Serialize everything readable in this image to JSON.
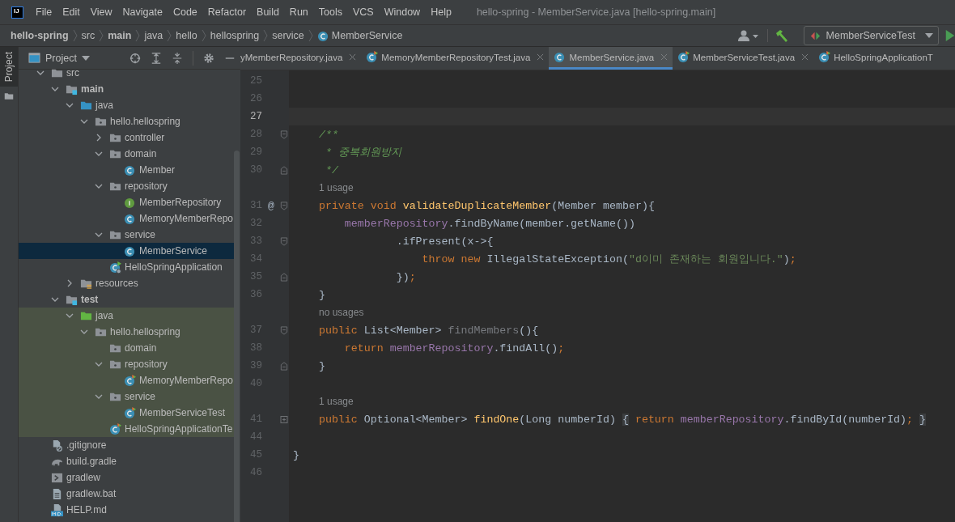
{
  "app": {
    "logo": "IJ",
    "title": "hello-spring - MemberService.java [hello-spring.main]"
  },
  "menu": [
    "File",
    "Edit",
    "View",
    "Navigate",
    "Code",
    "Refactor",
    "Build",
    "Run",
    "Tools",
    "VCS",
    "Window",
    "Help"
  ],
  "breadcrumbs": [
    {
      "label": "hello-spring",
      "bold": true
    },
    {
      "label": "src",
      "bold": false
    },
    {
      "label": "main",
      "bold": true
    },
    {
      "label": "java",
      "bold": false
    },
    {
      "label": "hello",
      "bold": false
    },
    {
      "label": "hellospring",
      "bold": false
    },
    {
      "label": "service",
      "bold": false
    },
    {
      "label": "MemberService",
      "bold": false,
      "kind": "class"
    }
  ],
  "run_config": {
    "label": "MemberServiceTest"
  },
  "side_stripe": {
    "label": "Project",
    "selected": true
  },
  "project": {
    "title": "Project",
    "tree": [
      {
        "label": "src",
        "kind": "folder",
        "expanded": true,
        "bold": false,
        "selected": false,
        "highlighted": false,
        "children": [
          {
            "label": "main",
            "kind": "source-folder",
            "expanded": true,
            "bold": true,
            "selected": false,
            "highlighted": false,
            "children": [
              {
                "label": "java",
                "kind": "java-folder",
                "expanded": true,
                "bold": false,
                "selected": false,
                "highlighted": false,
                "children": [
                  {
                    "label": "hello.hellospring",
                    "kind": "package",
                    "expanded": true,
                    "bold": false,
                    "selected": false,
                    "highlighted": false,
                    "children": [
                      {
                        "label": "controller",
                        "kind": "package",
                        "expanded": false,
                        "bold": false,
                        "selected": false,
                        "highlighted": false
                      },
                      {
                        "label": "domain",
                        "kind": "package",
                        "expanded": true,
                        "bold": false,
                        "selected": false,
                        "highlighted": false,
                        "children": [
                          {
                            "label": "Member",
                            "kind": "class",
                            "bold": false,
                            "selected": false,
                            "highlighted": false
                          }
                        ]
                      },
                      {
                        "label": "repository",
                        "kind": "package",
                        "expanded": true,
                        "bold": false,
                        "selected": false,
                        "highlighted": false,
                        "children": [
                          {
                            "label": "MemberRepository",
                            "kind": "interface",
                            "bold": false,
                            "selected": false,
                            "highlighted": false
                          },
                          {
                            "label": "MemoryMemberRepo",
                            "kind": "class",
                            "bold": false,
                            "selected": false,
                            "highlighted": false
                          }
                        ]
                      },
                      {
                        "label": "service",
                        "kind": "package",
                        "expanded": true,
                        "bold": false,
                        "selected": false,
                        "highlighted": false,
                        "children": [
                          {
                            "label": "MemberService",
                            "kind": "class",
                            "bold": false,
                            "selected": true,
                            "highlighted": false
                          }
                        ]
                      },
                      {
                        "label": "HelloSpringApplication",
                        "kind": "spring-app",
                        "bold": false,
                        "selected": false,
                        "highlighted": false
                      }
                    ]
                  }
                ]
              },
              {
                "label": "resources",
                "kind": "resources",
                "expanded": false,
                "bold": false,
                "selected": false,
                "highlighted": false
              }
            ]
          },
          {
            "label": "test",
            "kind": "source-folder",
            "expanded": true,
            "bold": true,
            "selected": false,
            "highlighted": false,
            "children": [
              {
                "label": "java",
                "kind": "test-java-folder",
                "expanded": true,
                "bold": false,
                "selected": false,
                "highlighted": true,
                "children": [
                  {
                    "label": "hello.hellospring",
                    "kind": "package",
                    "expanded": true,
                    "bold": false,
                    "selected": false,
                    "highlighted": true,
                    "children": [
                      {
                        "label": "domain",
                        "kind": "package",
                        "bold": false,
                        "selected": false,
                        "highlighted": true
                      },
                      {
                        "label": "repository",
                        "kind": "package",
                        "expanded": true,
                        "bold": false,
                        "selected": false,
                        "highlighted": true,
                        "children": [
                          {
                            "label": "MemoryMemberRepo",
                            "kind": "test-class",
                            "bold": false,
                            "selected": false,
                            "highlighted": true
                          }
                        ]
                      },
                      {
                        "label": "service",
                        "kind": "package",
                        "expanded": true,
                        "bold": false,
                        "selected": false,
                        "highlighted": true,
                        "children": [
                          {
                            "label": "MemberServiceTest",
                            "kind": "test-class",
                            "bold": false,
                            "selected": false,
                            "highlighted": true
                          }
                        ]
                      },
                      {
                        "label": "HelloSpringApplicationTe",
                        "kind": "test-class",
                        "bold": false,
                        "selected": false,
                        "highlighted": true
                      }
                    ]
                  }
                ]
              }
            ]
          }
        ]
      },
      {
        "label": ".gitignore",
        "kind": "gitignore",
        "bold": false,
        "selected": false,
        "highlighted": false
      },
      {
        "label": "build.gradle",
        "kind": "gradle",
        "bold": false,
        "selected": false,
        "highlighted": false
      },
      {
        "label": "gradlew",
        "kind": "script",
        "bold": false,
        "selected": false,
        "highlighted": false
      },
      {
        "label": "gradlew.bat",
        "kind": "text-file",
        "bold": false,
        "selected": false,
        "highlighted": false
      },
      {
        "label": "HELP.md",
        "kind": "markdown",
        "bold": false,
        "selected": false,
        "highlighted": false
      }
    ]
  },
  "tabs": [
    {
      "label": "yMemberRepository.java",
      "selected": false,
      "closable": true
    },
    {
      "label": "MemoryMemberRepositoryTest.java",
      "kind": "test-class",
      "selected": false,
      "closable": true
    },
    {
      "label": "MemberService.java",
      "kind": "class",
      "selected": true,
      "closable": true
    },
    {
      "label": "MemberServiceTest.java",
      "kind": "test-class",
      "selected": false,
      "closable": true
    },
    {
      "label": "HelloSpringApplicationT",
      "kind": "test-class",
      "selected": false,
      "closable": false
    }
  ],
  "code": [
    {
      "kind": "line",
      "number": "25",
      "current": false
    },
    {
      "kind": "line",
      "number": "26",
      "current": false
    },
    {
      "kind": "line",
      "number": "27",
      "current": true
    },
    {
      "kind": "fold-start",
      "number": "28",
      "current": false,
      "tokens": [
        {
          "text": "    /**",
          "kind": "comment"
        }
      ]
    },
    {
      "kind": "line",
      "number": "29",
      "current": false,
      "tokens": [
        {
          "text": "     * 중복회원방지",
          "kind": "comment"
        }
      ]
    },
    {
      "kind": "fold-end",
      "number": "30",
      "current": false,
      "tokens": [
        {
          "text": "     */",
          "kind": "comment"
        }
      ]
    },
    {
      "kind": "hint",
      "hint": "1 usage"
    },
    {
      "kind": "fold-start",
      "number": "31",
      "current": false,
      "marker": "@",
      "tokens": [
        {
          "text": "    private void ",
          "kind": "keyword"
        },
        {
          "text": "validateDuplicateMember",
          "kind": "method"
        },
        {
          "text": "(Member member){",
          "kind": "plain"
        }
      ]
    },
    {
      "kind": "line",
      "number": "32",
      "current": false,
      "tokens": [
        {
          "text": "        memberRepository",
          "kind": "field"
        },
        {
          "text": ".findByName(member.getName())",
          "kind": "plain"
        }
      ]
    },
    {
      "kind": "fold-start",
      "number": "33",
      "current": false,
      "tokens": [
        {
          "text": "                .ifPresent(x->{",
          "kind": "plain"
        }
      ]
    },
    {
      "kind": "line",
      "number": "34",
      "current": false,
      "tokens": [
        {
          "text": "                    throw new ",
          "kind": "keyword"
        },
        {
          "text": "IllegalStateException(",
          "kind": "plain"
        },
        {
          "text": "\"d이미 존재하는 회원입니다.\"",
          "kind": "string"
        },
        {
          "text": ")",
          "kind": "plain"
        },
        {
          "text": ";",
          "kind": "punct"
        }
      ]
    },
    {
      "kind": "fold-end",
      "number": "35",
      "current": false,
      "tokens": [
        {
          "text": "                })",
          "kind": "plain"
        },
        {
          "text": ";",
          "kind": "punct"
        }
      ]
    },
    {
      "kind": "line",
      "number": "36",
      "current": false,
      "tokens": [
        {
          "text": "    }",
          "kind": "plain"
        }
      ]
    },
    {
      "kind": "hint",
      "hint": "no usages"
    },
    {
      "kind": "fold-start",
      "number": "37",
      "current": false,
      "tokens": [
        {
          "text": "    public ",
          "kind": "keyword"
        },
        {
          "text": "List<Member> ",
          "kind": "plain"
        },
        {
          "text": "findMembers",
          "kind": "unused"
        },
        {
          "text": "(){",
          "kind": "plain"
        }
      ]
    },
    {
      "kind": "line",
      "number": "38",
      "current": false,
      "tokens": [
        {
          "text": "        return ",
          "kind": "keyword"
        },
        {
          "text": "memberRepository",
          "kind": "field"
        },
        {
          "text": ".findAll()",
          "kind": "plain"
        },
        {
          "text": ";",
          "kind": "punct"
        }
      ]
    },
    {
      "kind": "fold-end",
      "number": "39",
      "current": false,
      "tokens": [
        {
          "text": "    }",
          "kind": "plain"
        }
      ]
    },
    {
      "kind": "line",
      "number": "40",
      "current": false
    },
    {
      "kind": "hint",
      "hint": "1 usage"
    },
    {
      "kind": "folded",
      "number": "41",
      "current": false,
      "tokens": [
        {
          "text": "    public ",
          "kind": "keyword"
        },
        {
          "text": "Optional<Member> ",
          "kind": "plain"
        },
        {
          "text": "findOne",
          "kind": "method"
        },
        {
          "text": "(Long numberId) ",
          "kind": "plain"
        },
        {
          "text": "{",
          "kind": "folded"
        },
        {
          "text": " return ",
          "kind": "keyword"
        },
        {
          "text": "memberRepository",
          "kind": "field"
        },
        {
          "text": ".findById(numberId)",
          "kind": "plain"
        },
        {
          "text": "; ",
          "kind": "punct"
        },
        {
          "text": "}",
          "kind": "folded"
        }
      ]
    },
    {
      "kind": "line",
      "number": "44",
      "current": false
    },
    {
      "kind": "line",
      "number": "45",
      "current": false,
      "tokens": [
        {
          "text": "}",
          "kind": "plain"
        }
      ]
    },
    {
      "kind": "line",
      "number": "46",
      "current": false
    }
  ]
}
